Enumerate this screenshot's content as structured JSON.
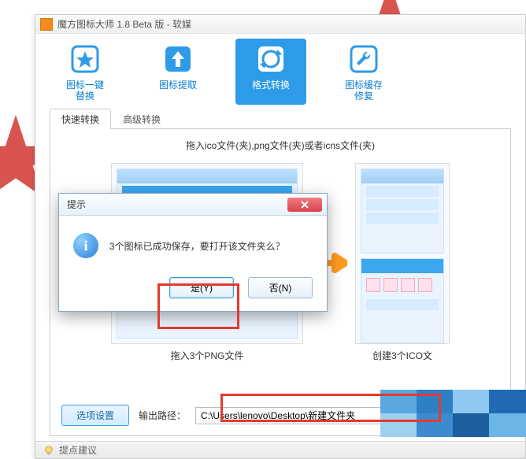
{
  "window": {
    "title": "魔方图标大师 1.8 Beta 版 - 软媒"
  },
  "toolbar": {
    "items": [
      {
        "label": "图标一键\n替换"
      },
      {
        "label": "图标提取"
      },
      {
        "label": "格式转换"
      },
      {
        "label": "图标缓存\n修复"
      }
    ]
  },
  "tabs": {
    "quick": "快速转换",
    "adv": "高级转换"
  },
  "panel": {
    "instruction": "拖入ico文件(夹),png文件(夹)或者icns文件(夹)",
    "left_caption": "拖入3个PNG文件",
    "right_caption": "创建3个ICO文"
  },
  "output": {
    "options_btn": "选项设置",
    "label": "输出路径：",
    "path": "C:\\Users\\lenovo\\Desktop\\新建文件夹"
  },
  "dialog": {
    "title": "提示",
    "message": "3个图标已成功保存，要打开该文件夹么？",
    "yes": "是(Y)",
    "no": "否(N)"
  },
  "footer": {
    "text": "提点建议"
  },
  "colors": {
    "accent": "#2d9be8",
    "red": "#e23b2e",
    "orange_arrow": "#ff9a1f"
  }
}
